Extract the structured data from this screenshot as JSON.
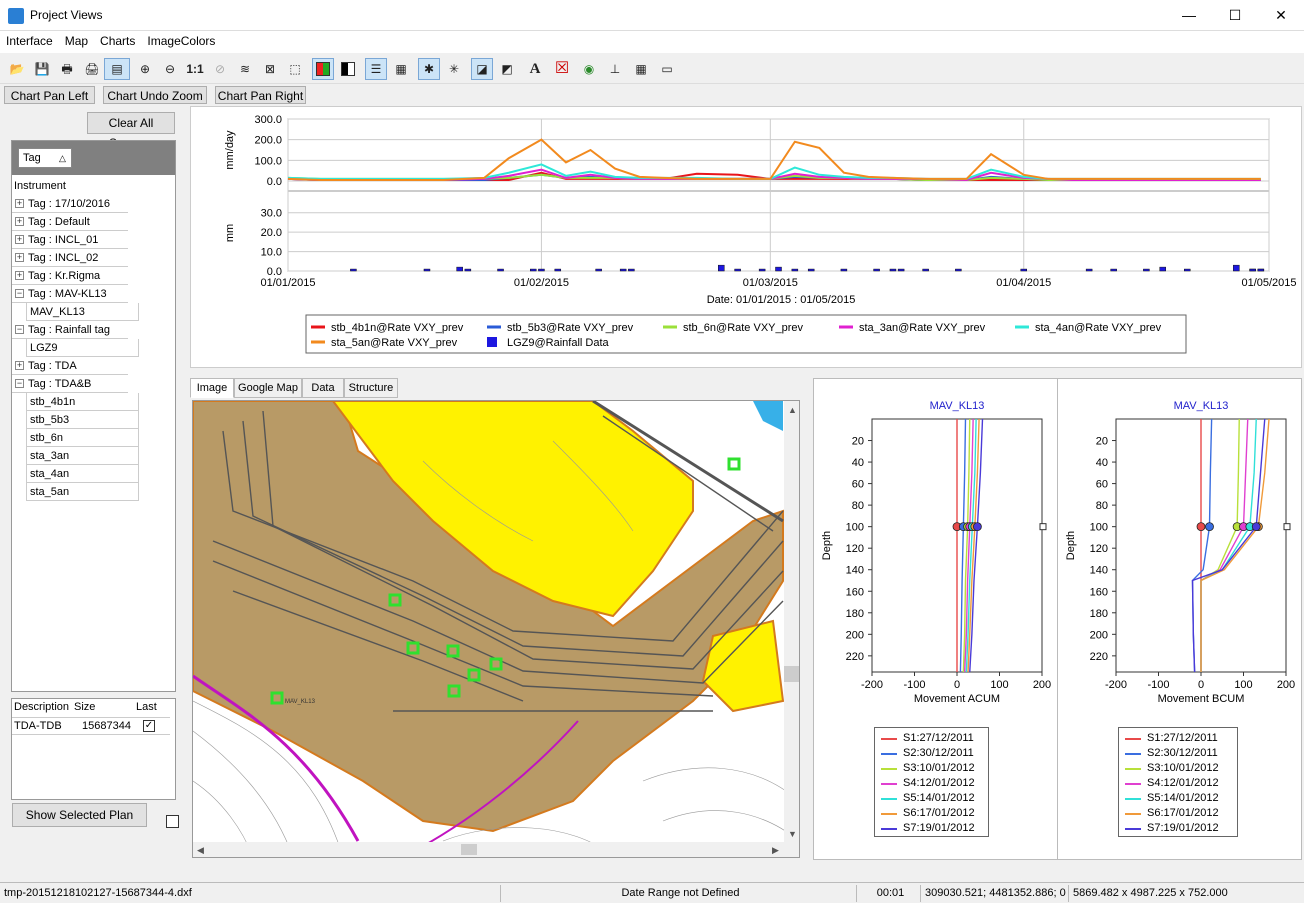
{
  "window": {
    "title": "Project Views",
    "minimize": "—",
    "maximize": "☐",
    "close": "✕"
  },
  "menu": [
    "Interface",
    "Map",
    "Charts",
    "ImageColors"
  ],
  "toolbar": {
    "icons": [
      "open-icon",
      "save-icon",
      "print-icon",
      "print-preview-icon",
      "image-export-icon",
      "zoom-in-icon",
      "zoom-out-icon",
      "zoom-reset-icon",
      "zoom-disabled-icon",
      "pan-icon",
      "fit-icon",
      "select-box-icon",
      "color-palette-icon",
      "bw-palette-icon",
      "list-icon",
      "list-alt-icon",
      "cursor-icon",
      "cursor-alt-icon",
      "region-icon",
      "region-alt-icon",
      "text-icon",
      "clear-icon",
      "eye-icon",
      "axis-icon",
      "grid-icon",
      "frame-icon"
    ],
    "zoom_reset_label": "1:1",
    "text_label": "A"
  },
  "chart_buttons": [
    "Chart Pan Left",
    "Chart Undo Zoom",
    "Chart Pan Right"
  ],
  "left": {
    "clear_all": "Clear All Sensors",
    "group_header": "Tag",
    "instrument_header": "Instrument",
    "tree": [
      {
        "type": "group",
        "label": "Tag : 17/10/2016",
        "expanded": false
      },
      {
        "type": "group",
        "label": "Tag : Default",
        "expanded": false
      },
      {
        "type": "group",
        "label": "Tag : INCL_01",
        "expanded": false
      },
      {
        "type": "group",
        "label": "Tag : INCL_02",
        "expanded": false
      },
      {
        "type": "group",
        "label": "Tag : Kr.Rigma",
        "expanded": false
      },
      {
        "type": "group",
        "label": "Tag : MAV-KL13",
        "expanded": true
      },
      {
        "type": "leaf",
        "label": "MAV_KL13"
      },
      {
        "type": "group",
        "label": "Tag : Rainfall tag",
        "expanded": true
      },
      {
        "type": "leaf",
        "label": "LGZ9"
      },
      {
        "type": "group",
        "label": "Tag : TDA",
        "expanded": false
      },
      {
        "type": "group",
        "label": "Tag : TDA&B",
        "expanded": true
      },
      {
        "type": "leaf",
        "label": "stb_4b1n"
      },
      {
        "type": "leaf",
        "label": "stb_5b3"
      },
      {
        "type": "leaf",
        "label": "stb_6n"
      },
      {
        "type": "leaf",
        "label": "sta_3an"
      },
      {
        "type": "leaf",
        "label": "sta_4an"
      },
      {
        "type": "leaf",
        "label": "sta_5an"
      }
    ],
    "plan_table": {
      "headers": [
        "Description",
        "Size",
        "Last"
      ],
      "rows": [
        {
          "description": "TDA-TDB",
          "size": "15687344",
          "last": true
        }
      ]
    },
    "show_plan": "Show Selected Plan"
  },
  "chart_data": [
    {
      "type": "line",
      "ylabel": "mm/day",
      "yticks": [
        "300.0",
        "200.0",
        "100.0",
        "0.0"
      ],
      "ylim": [
        0,
        300
      ],
      "x": [
        "01/01/2015",
        "05/01/2015",
        "10/01/2015",
        "15/01/2015",
        "20/01/2015",
        "25/01/2015",
        "28/01/2015",
        "01/02/2015",
        "04/02/2015",
        "07/02/2015",
        "10/02/2015",
        "13/02/2015",
        "16/02/2015",
        "20/02/2015",
        "25/02/2015",
        "01/03/2015",
        "04/03/2015",
        "07/03/2015",
        "10/03/2015",
        "13/03/2015",
        "16/03/2015",
        "20/03/2015",
        "25/03/2015",
        "28/03/2015",
        "01/04/2015",
        "04/04/2015",
        "07/04/2015",
        "12/04/2015",
        "20/04/2015",
        "30/04/2015"
      ],
      "series": [
        {
          "name": "stb_4b1n@Rate VXY_prev",
          "color": "#e8141a",
          "values": [
            10,
            5,
            5,
            5,
            5,
            5,
            5,
            40,
            10,
            10,
            10,
            10,
            10,
            35,
            30,
            10,
            10,
            10,
            10,
            10,
            10,
            5,
            5,
            5,
            5,
            5,
            5,
            5,
            5,
            5
          ]
        },
        {
          "name": "stb_5b3@Rate VXY_prev",
          "color": "#2a5bd7",
          "values": [
            10,
            5,
            5,
            5,
            5,
            5,
            15,
            30,
            15,
            20,
            15,
            10,
            10,
            10,
            10,
            10,
            20,
            15,
            15,
            10,
            10,
            5,
            5,
            20,
            10,
            5,
            5,
            5,
            5,
            5
          ]
        },
        {
          "name": "stb_6n@Rate VXY_prev",
          "color": "#9be03a",
          "values": [
            15,
            10,
            10,
            10,
            10,
            10,
            15,
            30,
            15,
            15,
            15,
            10,
            10,
            10,
            10,
            10,
            25,
            15,
            15,
            10,
            10,
            5,
            5,
            15,
            10,
            5,
            5,
            5,
            5,
            5
          ]
        },
        {
          "name": "sta_3an@Rate VXY_prev",
          "color": "#e020d0",
          "values": [
            10,
            5,
            5,
            5,
            5,
            10,
            25,
            55,
            15,
            30,
            15,
            10,
            10,
            10,
            10,
            10,
            35,
            20,
            15,
            10,
            10,
            10,
            5,
            40,
            15,
            10,
            5,
            5,
            5,
            5
          ]
        },
        {
          "name": "sta_4an@Rate VXY_prev",
          "color": "#2ee8d8",
          "values": [
            15,
            10,
            10,
            10,
            10,
            15,
            40,
            80,
            25,
            45,
            20,
            15,
            15,
            15,
            10,
            10,
            65,
            30,
            20,
            15,
            15,
            10,
            10,
            55,
            20,
            10,
            10,
            10,
            10,
            10
          ]
        },
        {
          "name": "sta_5an@Rate VXY_prev",
          "color": "#f28a1e",
          "values": [
            10,
            5,
            5,
            5,
            5,
            15,
            110,
            200,
            90,
            150,
            60,
            20,
            15,
            10,
            10,
            10,
            190,
            160,
            40,
            20,
            15,
            10,
            10,
            130,
            30,
            10,
            10,
            10,
            10,
            10
          ]
        }
      ]
    },
    {
      "type": "bar",
      "ylabel": "mm",
      "yticks": [
        "30.0",
        "20.0",
        "10.0",
        "0.0"
      ],
      "ylim": [
        0,
        35
      ],
      "xlabel": "Date: 01/01/2015 : 01/05/2015",
      "xticks": [
        "01/01/2015",
        "01/02/2015",
        "01/03/2015",
        "01/04/2015",
        "01/05/2015"
      ],
      "series": [
        {
          "name": "LGZ9@Rainfall Data",
          "color": "#1d17e0",
          "days": [
            8,
            17,
            21,
            22,
            26,
            30,
            31,
            33,
            38,
            41,
            42,
            53,
            55,
            58,
            60,
            62,
            64,
            68,
            72,
            74,
            75,
            78,
            82,
            90,
            98,
            101,
            105,
            107,
            110,
            116,
            118,
            119,
            133,
            126,
            119,
            129,
            133,
            135,
            118
          ],
          "values": [
            1,
            1,
            2,
            1,
            1,
            1,
            1,
            1,
            1,
            1,
            1,
            3,
            1,
            1,
            2,
            1,
            1,
            1,
            1,
            1,
            1,
            1,
            1,
            1,
            1,
            1,
            1,
            2,
            1,
            3,
            1,
            1,
            4,
            1,
            1,
            1,
            1,
            2,
            1
          ]
        }
      ]
    },
    {
      "type": "line",
      "title": "MAV_KL13",
      "xlabel": "Movement ACUM",
      "ylabel": "Depth",
      "xticks": [
        "-200",
        "-100",
        "0",
        "100",
        "200"
      ],
      "yticks": [
        "20",
        "40",
        "60",
        "80",
        "100",
        "120",
        "140",
        "160",
        "180",
        "200",
        "220"
      ],
      "xlim": [
        -200,
        200
      ],
      "ylim": [
        0,
        235
      ],
      "series": [
        {
          "name": "S1:27/12/2011",
          "color": "#e84a4a",
          "depth": [
            0,
            50,
            100,
            150,
            200,
            235
          ],
          "values": [
            0,
            0,
            0,
            0,
            0,
            0
          ]
        },
        {
          "name": "S2:30/12/2011",
          "color": "#3a6ee0",
          "depth": [
            0,
            50,
            100,
            150,
            200,
            235
          ],
          "values": [
            20,
            18,
            15,
            12,
            10,
            8
          ]
        },
        {
          "name": "S3:10/01/2012",
          "color": "#b8e03a",
          "depth": [
            0,
            50,
            100,
            150,
            200,
            235
          ],
          "values": [
            30,
            28,
            25,
            20,
            18,
            15
          ]
        },
        {
          "name": "S4:12/01/2012",
          "color": "#e040d0",
          "depth": [
            0,
            50,
            100,
            150,
            200,
            235
          ],
          "values": [
            38,
            35,
            30,
            25,
            22,
            18
          ]
        },
        {
          "name": "S5:14/01/2012",
          "color": "#30e0d8",
          "depth": [
            0,
            50,
            100,
            150,
            200,
            235
          ],
          "values": [
            45,
            42,
            36,
            30,
            26,
            22
          ]
        },
        {
          "name": "S6:17/01/2012",
          "color": "#f09a3a",
          "depth": [
            0,
            50,
            100,
            150,
            200,
            235
          ],
          "values": [
            52,
            48,
            42,
            35,
            30,
            26
          ]
        },
        {
          "name": "S7:19/01/2012",
          "color": "#4a3ad8",
          "depth": [
            0,
            50,
            100,
            150,
            200,
            235
          ],
          "values": [
            60,
            55,
            48,
            40,
            35,
            30
          ]
        }
      ]
    },
    {
      "type": "line",
      "title": "MAV_KL13",
      "xlabel": "Movement BCUM",
      "ylabel": "Depth",
      "xticks": [
        "-200",
        "-100",
        "0",
        "100",
        "200"
      ],
      "yticks": [
        "20",
        "40",
        "60",
        "80",
        "100",
        "120",
        "140",
        "160",
        "180",
        "200",
        "220"
      ],
      "xlim": [
        -200,
        200
      ],
      "ylim": [
        0,
        235
      ],
      "series": [
        {
          "name": "S1:27/12/2011",
          "color": "#e84a4a",
          "depth": [
            0,
            50,
            100,
            150,
            200,
            235
          ],
          "values": [
            0,
            0,
            0,
            0,
            0,
            0
          ]
        },
        {
          "name": "S2:30/12/2011",
          "color": "#3a6ee0",
          "depth": [
            0,
            50,
            100,
            140,
            150,
            200,
            235
          ],
          "values": [
            25,
            22,
            20,
            5,
            -20,
            -18,
            -15
          ]
        },
        {
          "name": "S3:10/01/2012",
          "color": "#b8e03a",
          "depth": [
            0,
            50,
            100,
            140,
            150,
            200,
            235
          ],
          "values": [
            90,
            88,
            85,
            40,
            0,
            0,
            0
          ]
        },
        {
          "name": "S4:12/01/2012",
          "color": "#e040d0",
          "depth": [
            0,
            50,
            100,
            140,
            150,
            200,
            235
          ],
          "values": [
            110,
            105,
            100,
            45,
            0,
            0,
            0
          ]
        },
        {
          "name": "S5:14/01/2012",
          "color": "#30e0d8",
          "depth": [
            0,
            50,
            100,
            140,
            150,
            200,
            235
          ],
          "values": [
            130,
            125,
            115,
            50,
            0,
            0,
            0
          ]
        },
        {
          "name": "S6:17/01/2012",
          "color": "#f09a3a",
          "depth": [
            0,
            50,
            100,
            140,
            150,
            200,
            235
          ],
          "values": [
            160,
            150,
            135,
            55,
            0,
            0,
            0
          ]
        },
        {
          "name": "S7:19/01/2012",
          "color": "#4a3ad8",
          "depth": [
            0,
            50,
            100,
            140,
            150,
            200,
            235
          ],
          "values": [
            150,
            140,
            130,
            50,
            -20,
            -18,
            -15
          ]
        }
      ]
    }
  ],
  "tabs": [
    "Image",
    "Google Map",
    "Data",
    "Structure"
  ],
  "map_labels": [
    "MAV_KL13"
  ],
  "status": {
    "file": "tmp-20151218102127-15687344-4.dxf",
    "center": "Date Range not Defined",
    "time": "00:01",
    "coords": "309030.521; 4481352.886; 0",
    "extent": "5869.482 x 4987.225 x 752.000"
  }
}
